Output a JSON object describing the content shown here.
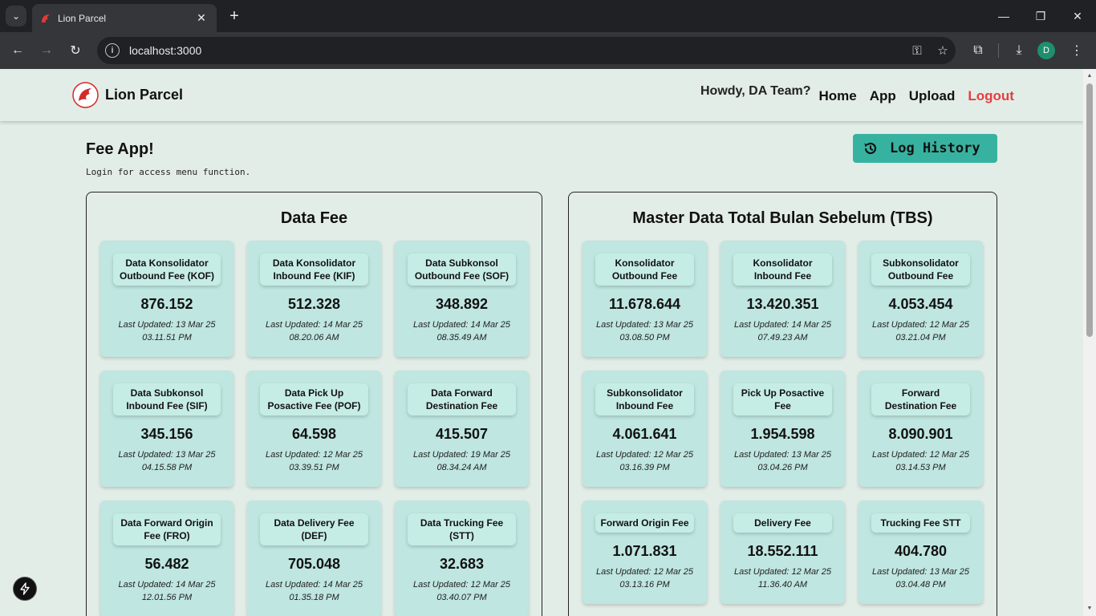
{
  "browser": {
    "tab_title": "Lion Parcel",
    "url": "localhost:3000",
    "profile_initial": "D"
  },
  "navbar": {
    "brand": "Lion Parcel",
    "greeting": "Howdy, DA Team?",
    "links": {
      "home": "Home",
      "app": "App",
      "upload": "Upload",
      "logout": "Logout"
    }
  },
  "header": {
    "title": "Fee App!",
    "subtitle": "Login for access menu function.",
    "log_button": "Log History"
  },
  "data_fee": {
    "title": "Data Fee",
    "cards": [
      {
        "label": "Data Konsolidator Outbound Fee (KOF)",
        "value": "876.152",
        "updated_line1": "Last Updated: 13 Mar 25",
        "updated_line2": "03.11.51 PM"
      },
      {
        "label": "Data Konsolidator Inbound Fee (KIF)",
        "value": "512.328",
        "updated_line1": "Last Updated: 14 Mar 25",
        "updated_line2": "08.20.06 AM"
      },
      {
        "label": "Data Subkonsol Outbound Fee (SOF)",
        "value": "348.892",
        "updated_line1": "Last Updated: 14 Mar 25",
        "updated_line2": "08.35.49 AM"
      },
      {
        "label": "Data Subkonsol Inbound Fee (SIF)",
        "value": "345.156",
        "updated_line1": "Last Updated: 13 Mar 25",
        "updated_line2": "04.15.58 PM"
      },
      {
        "label": "Data Pick Up Posactive Fee (POF)",
        "value": "64.598",
        "updated_line1": "Last Updated: 12 Mar 25",
        "updated_line2": "03.39.51 PM"
      },
      {
        "label": "Data Forward Destination Fee",
        "value": "415.507",
        "updated_line1": "Last Updated: 19 Mar 25",
        "updated_line2": "08.34.24 AM"
      },
      {
        "label": "Data Forward Origin Fee (FRO)",
        "value": "56.482",
        "updated_line1": "Last Updated: 14 Mar 25",
        "updated_line2": "12.01.56 PM"
      },
      {
        "label": "Data Delivery Fee (DEF)",
        "value": "705.048",
        "updated_line1": "Last Updated: 14 Mar 25",
        "updated_line2": "01.35.18 PM"
      },
      {
        "label": "Data Trucking Fee (STT)",
        "value": "32.683",
        "updated_line1": "Last Updated: 12 Mar 25",
        "updated_line2": "03.40.07 PM"
      }
    ]
  },
  "master_tbs": {
    "title": "Master Data Total Bulan Sebelum (TBS)",
    "cards": [
      {
        "label": "Konsolidator Outbound Fee",
        "value": "11.678.644",
        "updated_line1": "Last Updated: 13 Mar 25",
        "updated_line2": "03.08.50 PM"
      },
      {
        "label": "Konsolidator Inbound Fee",
        "value": "13.420.351",
        "updated_line1": "Last Updated: 14 Mar 25",
        "updated_line2": "07.49.23 AM"
      },
      {
        "label": "Subkonsolidator Outbound Fee",
        "value": "4.053.454",
        "updated_line1": "Last Updated: 12 Mar 25",
        "updated_line2": "03.21.04 PM"
      },
      {
        "label": "Subkonsolidator Inbound Fee",
        "value": "4.061.641",
        "updated_line1": "Last Updated: 12 Mar 25",
        "updated_line2": "03.16.39 PM"
      },
      {
        "label": "Pick Up Posactive Fee",
        "value": "1.954.598",
        "updated_line1": "Last Updated: 13 Mar 25",
        "updated_line2": "03.04.26 PM"
      },
      {
        "label": "Forward Destination Fee",
        "value": "8.090.901",
        "updated_line1": "Last Updated: 12 Mar 25",
        "updated_line2": "03.14.53 PM"
      },
      {
        "label": "Forward Origin Fee",
        "value": "1.071.831",
        "updated_line1": "Last Updated: 12 Mar 25",
        "updated_line2": "03.13.16 PM"
      },
      {
        "label": "Delivery Fee",
        "value": "18.552.111",
        "updated_line1": "Last Updated: 12 Mar 25",
        "updated_line2": "11.36.40 AM"
      },
      {
        "label": "Trucking Fee STT",
        "value": "404.780",
        "updated_line1": "Last Updated: 13 Mar 25",
        "updated_line2": "03.04.48 PM"
      }
    ]
  },
  "colors": {
    "accent": "#38b2a0",
    "card_bg": "#bfe6e0",
    "page_bg": "#e3ede8",
    "logout": "#e53e3e",
    "brand_red": "#d42a2a"
  }
}
